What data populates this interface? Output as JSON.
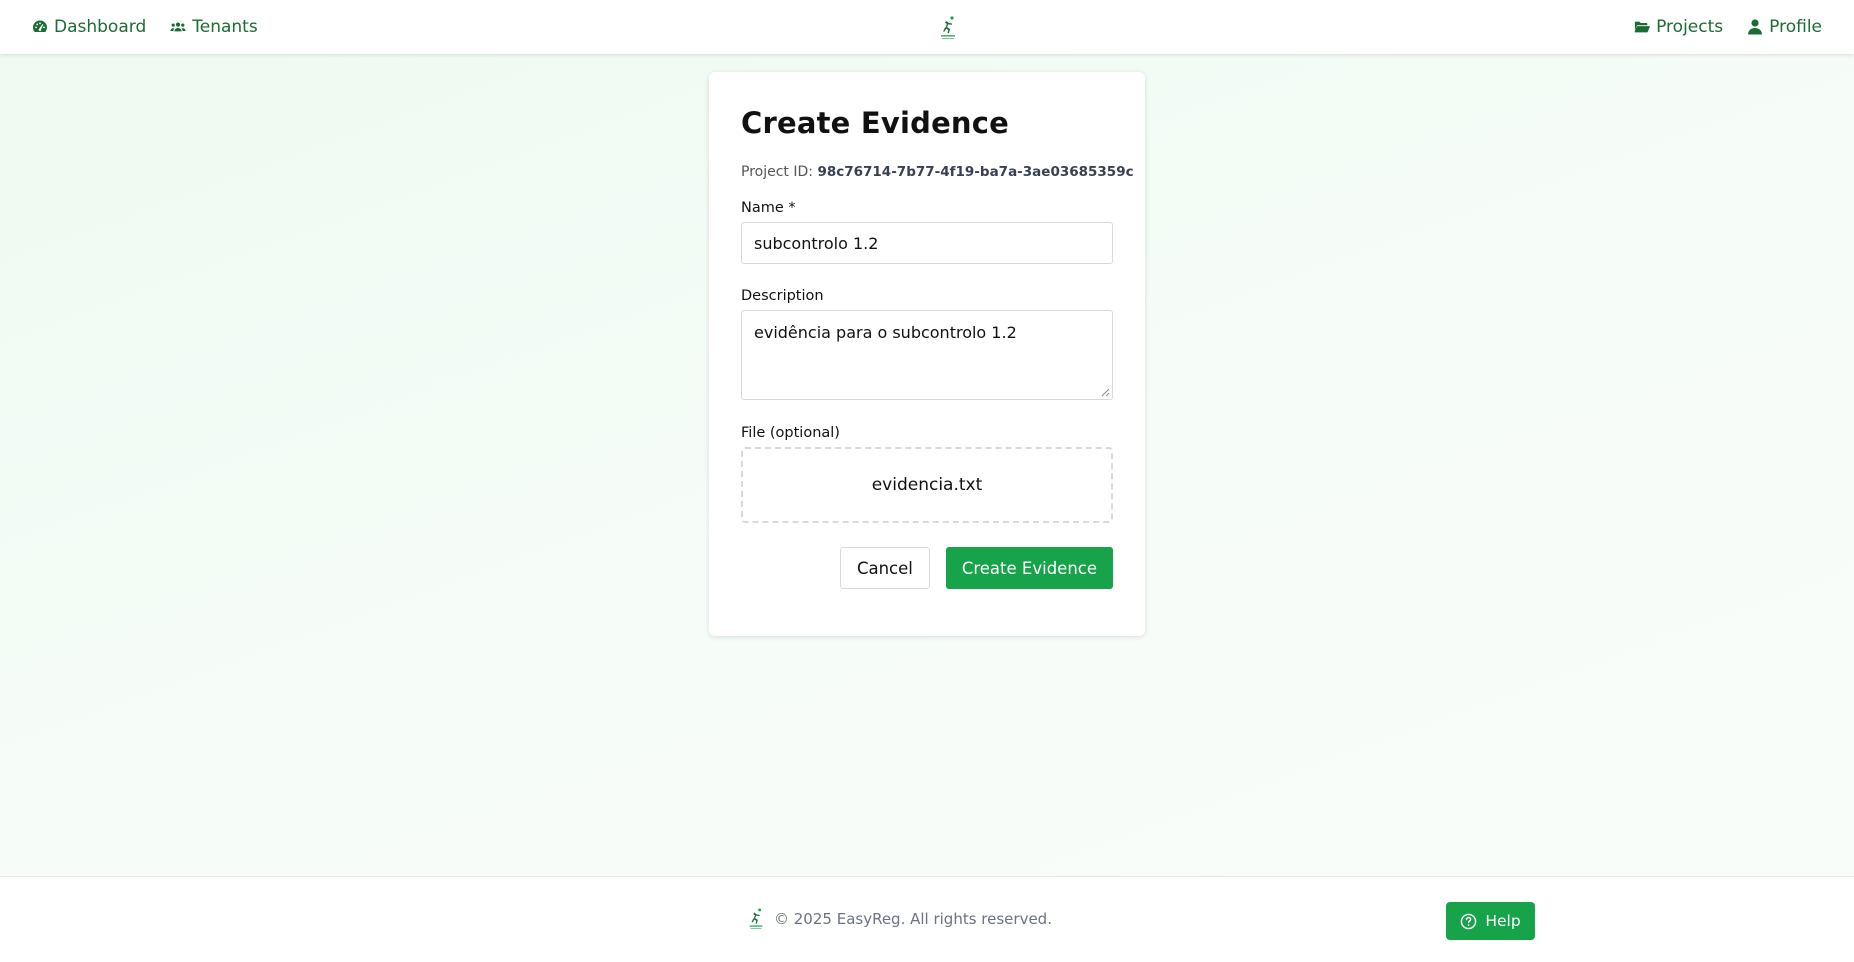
{
  "nav": {
    "dashboard_label": "Dashboard",
    "tenants_label": "Tenants",
    "projects_label": "Projects",
    "profile_label": "Profile"
  },
  "brand": {
    "name": "EASYREG",
    "accent_color": "#16a34a",
    "link_color": "#1b6b34"
  },
  "form": {
    "title": "Create Evidence",
    "project_id_label": "Project ID:",
    "project_id": "98c76714-7b77-4f19-ba7a-3ae03685359c",
    "name_label": "Name *",
    "name_value": "subcontrolo 1.2",
    "description_label": "Description",
    "description_value": "evidência para o subcontrolo 1.2",
    "file_label": "File (optional)",
    "file_name": "evidencia.txt",
    "cancel_label": "Cancel",
    "submit_label": "Create Evidence"
  },
  "footer": {
    "copyright": "© 2025 EasyReg. All rights reserved.",
    "help_label": "Help"
  }
}
